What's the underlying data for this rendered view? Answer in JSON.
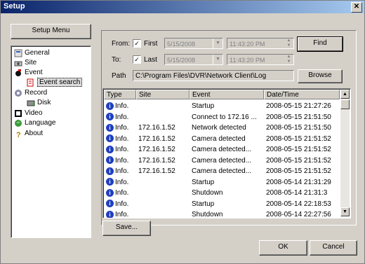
{
  "window": {
    "title": "Setup",
    "close_glyph": "✕"
  },
  "setup_menu_button": "Setup Menu",
  "tree": {
    "items": [
      {
        "label": "General",
        "icon": "general-icon"
      },
      {
        "label": "Site",
        "icon": "site-icon"
      },
      {
        "label": "Event",
        "icon": "event-icon"
      },
      {
        "label": "Event search",
        "icon": "event-search-icon",
        "selected": true
      },
      {
        "label": "Record",
        "icon": "record-icon"
      },
      {
        "label": "Disk",
        "icon": "disk-icon"
      },
      {
        "label": "Video",
        "icon": "video-icon"
      },
      {
        "label": "Language",
        "icon": "language-icon"
      },
      {
        "label": "About",
        "icon": "about-icon"
      }
    ]
  },
  "search": {
    "from_label": "From:",
    "from_check_label": "First",
    "from_date": "5/15/2008",
    "from_time": "11:43:20 PM",
    "to_label": "To:",
    "to_check_label": "Last",
    "to_date": "5/15/2008",
    "to_time": "11:43:20 PM",
    "find_label": "Find",
    "path_label": "Path",
    "path_value": "C:\\Program Files\\DVR\\Network Client\\Log",
    "browse_label": "Browse"
  },
  "table": {
    "columns": [
      "Type",
      "Site",
      "Event",
      "Date/Time"
    ],
    "rows": [
      [
        "Info.",
        "",
        "Startup",
        "2008-05-15 21:27:26"
      ],
      [
        "Info.",
        "",
        "Connect to 172.16 ...",
        "2008-05-15 21:51:50"
      ],
      [
        "Info.",
        "172.16.1.52",
        "Network detected",
        "2008-05-15 21:51:50"
      ],
      [
        "Info.",
        "172.16.1.52",
        "Camera detected",
        "2008-05-15 21:51:52"
      ],
      [
        "Info.",
        "172.16.1.52",
        "Camera detected...",
        "2008-05-15 21:51:52"
      ],
      [
        "Info.",
        "172.16.1.52",
        "Camera detected...",
        "2008-05-15 21:51:52"
      ],
      [
        "Info.",
        "172.16.1.52",
        "Camera detected...",
        "2008-05-15 21:51:52"
      ],
      [
        "Info.",
        "",
        "Startup",
        "2008-05-14 21:31:29"
      ],
      [
        "Info.",
        "",
        "Shutdown",
        "2008-05-14 21:31:3"
      ],
      [
        "Info.",
        "",
        "Startup",
        "2008-05-14 22:18:53"
      ],
      [
        "Info.",
        "",
        "Shutdown",
        "2008-05-14 22:27:56"
      ]
    ]
  },
  "save_label": "Save...",
  "ok_label": "OK",
  "cancel_label": "Cancel"
}
